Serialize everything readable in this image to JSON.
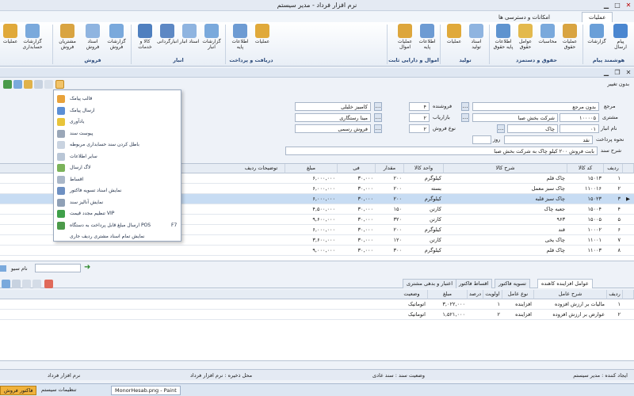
{
  "window": {
    "title": "نرم افزار فرداد - مدیر سیستم"
  },
  "ribbon_tabs": [
    "عملیات",
    "امکانات و دسترسی ها"
  ],
  "ribbon_groups": [
    {
      "label": "هوشمند پیام",
      "buttons": [
        "پیام ارسال",
        "گزارشات"
      ]
    },
    {
      "label": "حقوق و دستمزد",
      "buttons": [
        "عملیات حقوق",
        "محاسبات",
        "عوامل حقوق",
        "اطلاعات پایه حقوق"
      ]
    },
    {
      "label": "تولید",
      "buttons": [
        "اسناد تولید",
        "عملیات"
      ]
    },
    {
      "label": "اموال و دارایی ثابت",
      "buttons": [
        "اطلاعات پایه",
        "عملیات اموال"
      ]
    },
    {
      "label": "دریافت و پرداخت",
      "buttons": [
        "عملیات",
        "اطلاعات پایه"
      ]
    },
    {
      "label": "انبار",
      "buttons": [
        "گزارشات انبار",
        "اسناد انبار",
        "انبارگردانی",
        "کالا و خدمات"
      ]
    },
    {
      "label": "فروش",
      "buttons": [
        "گزارشات فروش",
        "اسناد فروش",
        "مشتریان فروش"
      ]
    },
    {
      "label": "",
      "buttons": [
        "گزارشات حسابداری",
        "عملیات"
      ]
    }
  ],
  "inner": {
    "status_label": "بدون تغییر"
  },
  "menu_items": [
    {
      "label": "قالب پیامک",
      "icon": "template-icon",
      "color": "#e8a23a"
    },
    {
      "label": "ارسال پیامک",
      "icon": "sms-icon",
      "color": "#5b8fd6"
    },
    {
      "label": "یادآوری",
      "icon": "warning-icon",
      "color": "#e8c43a"
    },
    {
      "label": "پیوست سند",
      "icon": "attachment-icon",
      "color": "#9aa7b8"
    },
    {
      "label": "باطل کردن سند حسابداری مربوطه",
      "icon": "cancel-icon",
      "color": "#c9d3e0"
    },
    {
      "label": "سایر اطلاعات",
      "icon": "info-icon",
      "color": "#b9c6d6"
    },
    {
      "label": "لاگ ارسال",
      "icon": "log-icon",
      "color": "#7bb35a"
    },
    {
      "label": "اقساط",
      "icon": "installment-icon",
      "color": "#aab7c8"
    },
    {
      "label": "نمایش اسناد تسویه فاکتور",
      "icon": "settle-icon",
      "color": "#6e90c2"
    },
    {
      "label": "نمایش آنالیز سند",
      "icon": "analysis-icon",
      "color": "#8fa0b6"
    },
    {
      "label": "تنظیم مجدد قیمت VIP",
      "icon": "vip-icon",
      "color": "#3fa04a"
    },
    {
      "label": "ارسال مبلغ قابل پرداخت به دستگاه POS",
      "icon": "pos-icon",
      "color": "#4c9a4a",
      "shortcut": "F7"
    },
    {
      "label": "نمایش تمام اسناد مشتری ردیف جاری",
      "icon": "customer-docs-icon",
      "color": "#ffffff"
    }
  ],
  "form": {
    "reference_label": "مرجع",
    "reference_value": "بدون مرجع",
    "customer_label": "مشتری",
    "customer_code": "۱۰۰۰۰۵",
    "customer_name": "شرکت بخش صبا",
    "warehouse_label": "نام انبار",
    "warehouse_code": "۰۱",
    "warehouse_name": "چاک",
    "payment_label": "نحوه پرداخت",
    "payment_value": "نقد",
    "days_label": "روز",
    "seller_label": "فروشنده",
    "seller_code": "۴",
    "seller_name": "کامبیز خلیلی",
    "marketer_label": "بازاریاب",
    "marketer_code": "۲",
    "marketer_name": "مینا رستگاری",
    "saletype_label": "نوع فروش",
    "saletype_code": "۲",
    "saletype_name": "فروش رسمی",
    "desc_label": "شرح سند",
    "desc_value": "بابت فروش ۲۰۰ کیلو چاک به شرکت بخش صبا"
  },
  "grid": {
    "columns": [
      "ردیف",
      "کد کالا",
      "شرح کالا",
      "واحد کالا",
      "مقدار",
      "فی",
      "مبلغ",
      "توضیحات ردیف"
    ],
    "rows": [
      [
        "۱",
        "۱۵۰۱۳",
        "چاک قلم",
        "کیلوگرم",
        "۲۰۰",
        "۳۰,۰۰۰",
        "۶,۰۰۰,۰۰۰",
        ""
      ],
      [
        "۲",
        "۱۱۰۰۱۶",
        "چاک سبز معمل",
        "بسته",
        "۲۰۰",
        "۳۰,۰۰۰",
        "۶,۰۰۰,۰۰۰",
        ""
      ],
      [
        "۳",
        "۱۵۰۲۳",
        "چاک سبز قلبه",
        "کیلوگرم",
        "۲۰۰",
        "۳۰,۰۰۰",
        "۶,۰۰۰,۰۰۰",
        ""
      ],
      [
        "۴",
        "۱۵۰۰۴",
        "جعبه چاک",
        "کارتن",
        "۱۵۰",
        "۳۰,۰۰۰",
        "۴,۵۰۰,۰۰۰",
        ""
      ],
      [
        "۵",
        "۱۵۰۰۵",
        "۹۶۳",
        "کارتن",
        "۳۲۰",
        "۳۰,۰۰۰",
        "۹,۶۰۰,۰۰۰",
        ""
      ],
      [
        "۶",
        "۱۰۰۰۲",
        "قند",
        "کیلوگرم",
        "۲۰۰",
        "۳۰,۰۰۰",
        "۶,۰۰۰,۰۰۰",
        ""
      ],
      [
        "۷",
        "۱۱۰۰۱",
        "چاک یخی",
        "کارتن",
        "۱۲۰",
        "۳۰,۰۰۰",
        "۳,۶۰۰,۰۰۰",
        ""
      ],
      [
        "۸",
        "۱۱۰۰۳",
        "چاک قلم",
        "کیلوگرم",
        "۳۰۰",
        "۳۰,۰۰۰",
        "۹,۰۰۰,۰۰۰",
        ""
      ]
    ]
  },
  "namebar": {
    "label": "نام سیو"
  },
  "bottom_tabs": [
    "عوامل افزاینده کاهنده",
    "تسویه فاکتور",
    "اقساط فاکتور",
    "اعتبار و بدهی مشتری"
  ],
  "bgrid": {
    "columns": [
      "ردیف",
      "شرح عامل",
      "نوع عامل",
      "اولویت",
      "درصد",
      "مبلغ",
      "وضعیت"
    ],
    "rows": [
      [
        "۱",
        "مالیات بر ارزش افزوده",
        "افزاینده",
        "۱",
        "",
        "۳,۰۲۲,۰۰۰",
        "اتوماتیک"
      ],
      [
        "۲",
        "عوارض بر ارزش افزوده",
        "افزاینده",
        "۲",
        "",
        "۱,۵۲۱,۰۰۰",
        "اتوماتیک"
      ]
    ]
  },
  "status": {
    "creator": "ایجاد کننده : مدیر سیستم",
    "doc_state": "وضعیت سند : سند عادی",
    "editor": "محل ذخیره : نرم افزار فرداد",
    "software": "نرم افزار فرداد"
  },
  "taskbar": {
    "item1": "MonorHesab.png - Paint",
    "item2": "تنظیمات سیستم",
    "item3": "فاکتور فروش"
  }
}
